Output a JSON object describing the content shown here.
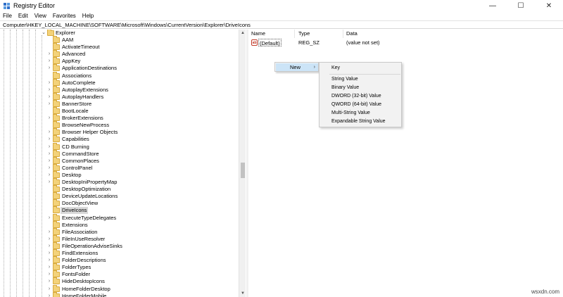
{
  "window": {
    "title": "Registry Editor",
    "controls": {
      "minimize": "—",
      "maximize": "☐",
      "close": "✕"
    }
  },
  "menubar": {
    "items": [
      "File",
      "Edit",
      "View",
      "Favorites",
      "Help"
    ]
  },
  "address": {
    "path": "Computer\\HKEY_LOCAL_MACHINE\\SOFTWARE\\Microsoft\\Windows\\CurrentVersion\\Explorer\\DriveIcons"
  },
  "tree": {
    "parent": {
      "label": "Explorer",
      "expanded": true
    },
    "selected_label": "DriveIcons",
    "items": [
      {
        "label": "AAM",
        "expandable": false
      },
      {
        "label": "ActivateTimeout",
        "expandable": false
      },
      {
        "label": "Advanced",
        "expandable": true
      },
      {
        "label": "AppKey",
        "expandable": true
      },
      {
        "label": "ApplicationDestinations",
        "expandable": true
      },
      {
        "label": "Associations",
        "expandable": false
      },
      {
        "label": "AutoComplete",
        "expandable": true
      },
      {
        "label": "AutoplayExtensions",
        "expandable": true
      },
      {
        "label": "AutoplayHandlers",
        "expandable": true
      },
      {
        "label": "BannerStore",
        "expandable": true
      },
      {
        "label": "BootLocale",
        "expandable": false
      },
      {
        "label": "BrokerExtensions",
        "expandable": true
      },
      {
        "label": "BrowseNewProcess",
        "expandable": false
      },
      {
        "label": "Browser Helper Objects",
        "expandable": true
      },
      {
        "label": "Capabilities",
        "expandable": true
      },
      {
        "label": "CD Burning",
        "expandable": true
      },
      {
        "label": "CommandStore",
        "expandable": true
      },
      {
        "label": "CommonPlaces",
        "expandable": true
      },
      {
        "label": "ControlPanel",
        "expandable": true
      },
      {
        "label": "Desktop",
        "expandable": true
      },
      {
        "label": "DesktopIniPropertyMap",
        "expandable": true
      },
      {
        "label": "DesktopOptimization",
        "expandable": false
      },
      {
        "label": "DeviceUpdateLocations",
        "expandable": false
      },
      {
        "label": "DocObjectView",
        "expandable": false
      },
      {
        "label": "DriveIcons",
        "expandable": false
      },
      {
        "label": "ExecuteTypeDelegates",
        "expandable": true
      },
      {
        "label": "Extensions",
        "expandable": false
      },
      {
        "label": "FileAssociation",
        "expandable": true
      },
      {
        "label": "FileInUseResolver",
        "expandable": true
      },
      {
        "label": "FileOperationAdviseSinks",
        "expandable": true
      },
      {
        "label": "FindExtensions",
        "expandable": true
      },
      {
        "label": "FolderDescriptions",
        "expandable": true
      },
      {
        "label": "FolderTypes",
        "expandable": true
      },
      {
        "label": "FontsFolder",
        "expandable": true
      },
      {
        "label": "HideDesktopIcons",
        "expandable": true
      },
      {
        "label": "HomeFolderDesktop",
        "expandable": true
      },
      {
        "label": "HomeFolderMobile",
        "expandable": true
      }
    ]
  },
  "list": {
    "columns": {
      "name": "Name",
      "type": "Type",
      "data": "Data"
    },
    "rows": [
      {
        "icon": "ab-string-icon",
        "icon_text": "ab",
        "name": "(Default)",
        "type": "REG_SZ",
        "data": "(value not set)"
      }
    ]
  },
  "context_menu": {
    "item": {
      "label": "New",
      "arrow": "›"
    },
    "submenu": [
      "Key",
      "String Value",
      "Binary Value",
      "DWORD (32-bit) Value",
      "QWORD (64-bit) Value",
      "Multi-String Value",
      "Expandable String Value"
    ]
  },
  "tree_scroll": {
    "position": 0.53,
    "visible_fraction": 0.06
  },
  "watermark": "wsxdn.com",
  "colors": {
    "folder": "#f3d27a",
    "highlight": "#cce4f7",
    "selection": "#d9d9d9",
    "string_icon": "#c23b2a"
  }
}
